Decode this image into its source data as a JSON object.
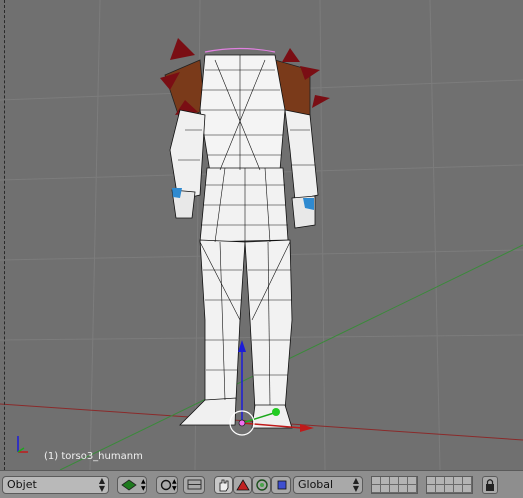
{
  "viewport": {
    "object_label": "(1) torso3_humanm"
  },
  "toolbar": {
    "mode_select": "Objet",
    "orientation_select": "Global",
    "icons": [
      "view-shading-icon",
      "snap-icon",
      "hand-tool-icon",
      "rotate-icon",
      "scale-icon",
      "layer-icon",
      "lock-icon"
    ]
  },
  "colors": {
    "viewport_bg": "#707070",
    "x_axis": "#b01a1a",
    "y_axis": "#1a8a1a",
    "z_axis": "#1a1ad8",
    "toolbar_bg": "#8e8e8e"
  }
}
